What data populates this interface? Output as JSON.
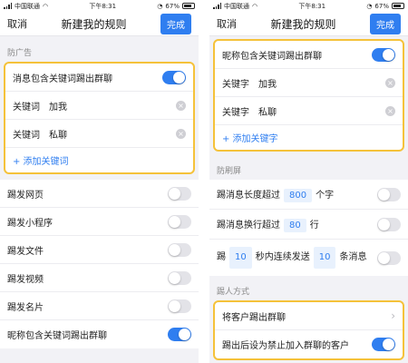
{
  "colors": {
    "accent": "#2f7ef0",
    "highlight_border": "#f5c23a",
    "toggle_off": "#e3e3e8"
  },
  "left": {
    "status": {
      "carrier": "中国联通",
      "time": "下午8:31",
      "battery": "67%"
    },
    "nav": {
      "cancel": "取消",
      "title": "新建我的规则",
      "done": "完成"
    },
    "section_antiad": "防广告",
    "highlight_group": {
      "toggle_label": "消息包含关键词踢出群聊",
      "toggle_on": true,
      "keywords": [
        {
          "label": "关键词",
          "value": "加我"
        },
        {
          "label": "关键词",
          "value": "私聊"
        }
      ],
      "add_label": "+ 添加关键词"
    },
    "rows": [
      {
        "label": "踢发网页",
        "on": false
      },
      {
        "label": "踢发小程序",
        "on": false
      },
      {
        "label": "踢发文件",
        "on": false
      },
      {
        "label": "踢发视频",
        "on": false
      },
      {
        "label": "踢发名片",
        "on": false
      },
      {
        "label": "昵称包含关键词踢出群聊",
        "on": true
      }
    ]
  },
  "right": {
    "status": {
      "carrier": "中国联通",
      "time": "下午8:31",
      "battery": "67%"
    },
    "nav": {
      "cancel": "取消",
      "title": "新建我的规则",
      "done": "完成"
    },
    "highlight_group": {
      "toggle_label": "昵称包含关键词踢出群聊",
      "toggle_on": true,
      "keywords": [
        {
          "label": "关键字",
          "value": "加我"
        },
        {
          "label": "关键字",
          "value": "私聊"
        }
      ],
      "add_label": "+ 添加关键字"
    },
    "section_antiflood": "防刷屏",
    "flood": {
      "len_prefix": "踢消息长度超过",
      "len_value": "800",
      "len_suffix": "个字",
      "len_on": false,
      "lines_prefix": "踢消息换行超过",
      "lines_value": "80",
      "lines_suffix": "行",
      "lines_on": false,
      "rate_prefix": "踢",
      "rate_seconds": "10",
      "rate_mid": "秒内连续发送",
      "rate_count": "10",
      "rate_suffix": "条消息",
      "rate_on": false
    },
    "section_kick": "踢人方式",
    "kick": {
      "kick_label": "将客户踢出群聊",
      "ban_label": "踢出后设为禁止加入群聊的客户",
      "ban_on": true
    }
  }
}
